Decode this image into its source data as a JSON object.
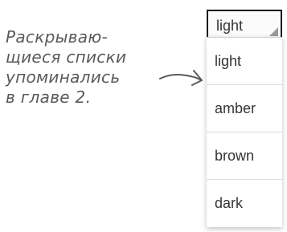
{
  "annotation": {
    "lines": [
      "Раскрываю-",
      "щиеся списки",
      "упоминались",
      "в главе 2."
    ]
  },
  "spinner": {
    "selected": "light",
    "options": [
      "light",
      "amber",
      "brown",
      "dark"
    ]
  },
  "icons": {
    "spinner_indicator": "dropdown-triangle-icon",
    "pointer": "curved-arrow-icon"
  },
  "colors": {
    "annotation_text": "#5a5a5a",
    "border": "#111111",
    "divider": "#dddddd"
  }
}
